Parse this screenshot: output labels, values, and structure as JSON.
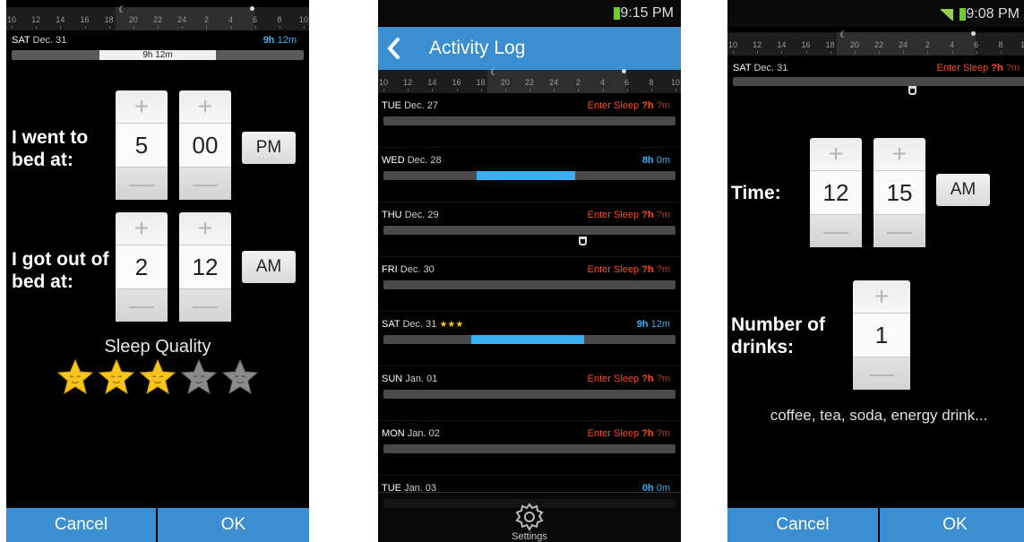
{
  "ruler_ticks": [
    "10",
    "12",
    "14",
    "16",
    "18",
    "20",
    "22",
    "24",
    "2",
    "4",
    "6",
    "8",
    "10"
  ],
  "panel1": {
    "day": "SAT",
    "date": "Dec. 31",
    "dur_h": "9h",
    "dur_m": "12m",
    "bar_label": "9h 12m",
    "bed_label": "I went to bed at:",
    "bed_hour": "5",
    "bed_min": "00",
    "bed_ampm": "PM",
    "out_label": "I got out of bed at:",
    "out_hour": "2",
    "out_min": "12",
    "out_ampm": "AM",
    "quality_label": "Sleep Quality",
    "quality_stars": 3,
    "quality_max": 5,
    "cancel": "Cancel",
    "ok": "OK",
    "plus": "+",
    "minus": "—"
  },
  "panel2": {
    "status_time": "9:15 PM",
    "title": "Activity Log",
    "back_icon": "chevron-left-icon",
    "rows": [
      {
        "day": "TUE",
        "date": "Dec. 27",
        "kind": "enter",
        "text": "Enter Sleep",
        "h": "?h",
        "m": "?m"
      },
      {
        "day": "WED",
        "date": "Dec. 28",
        "kind": "dur",
        "h": "8h",
        "m": "0m"
      },
      {
        "day": "THU",
        "date": "Dec. 29",
        "kind": "enter",
        "text": "Enter Sleep",
        "h": "?h",
        "m": "?m"
      },
      {
        "day": "FRI",
        "date": "Dec. 30",
        "kind": "enter",
        "text": "Enter Sleep",
        "h": "?h",
        "m": "?m"
      },
      {
        "day": "SAT",
        "date": "Dec. 31",
        "stars": "★★★",
        "kind": "dur",
        "h": "9h",
        "m": "12m"
      },
      {
        "day": "SUN",
        "date": "Jan. 01",
        "kind": "enter",
        "text": "Enter Sleep",
        "h": "?h",
        "m": "?m"
      },
      {
        "day": "MON",
        "date": "Jan. 02",
        "kind": "enter",
        "text": "Enter Sleep",
        "h": "?h",
        "m": "?m"
      },
      {
        "day": "TUE",
        "date": "Jan. 03",
        "kind": "dur",
        "h": "0h",
        "m": "0m"
      }
    ],
    "settings_label": "Settings"
  },
  "panel3": {
    "status_time": "9:08 PM",
    "day": "SAT",
    "date": "Dec. 31",
    "enter_text": "Enter Sleep",
    "h": "?h",
    "m": "?m",
    "time_label": "Time:",
    "hour": "12",
    "min": "15",
    "ampm": "AM",
    "drinks_label": "Number of drinks:",
    "drinks": "1",
    "hint": "coffee, tea, soda, energy drink...",
    "cancel": "Cancel",
    "ok": "OK",
    "plus": "+",
    "minus": "—"
  },
  "colors": {
    "accent_blue": "#3a8ed1",
    "sleep_bar": "#38b0f0",
    "enter_red": "#ff4a1f",
    "star_gold": "#f7c51e",
    "star_gray": "#8a8a8a"
  }
}
